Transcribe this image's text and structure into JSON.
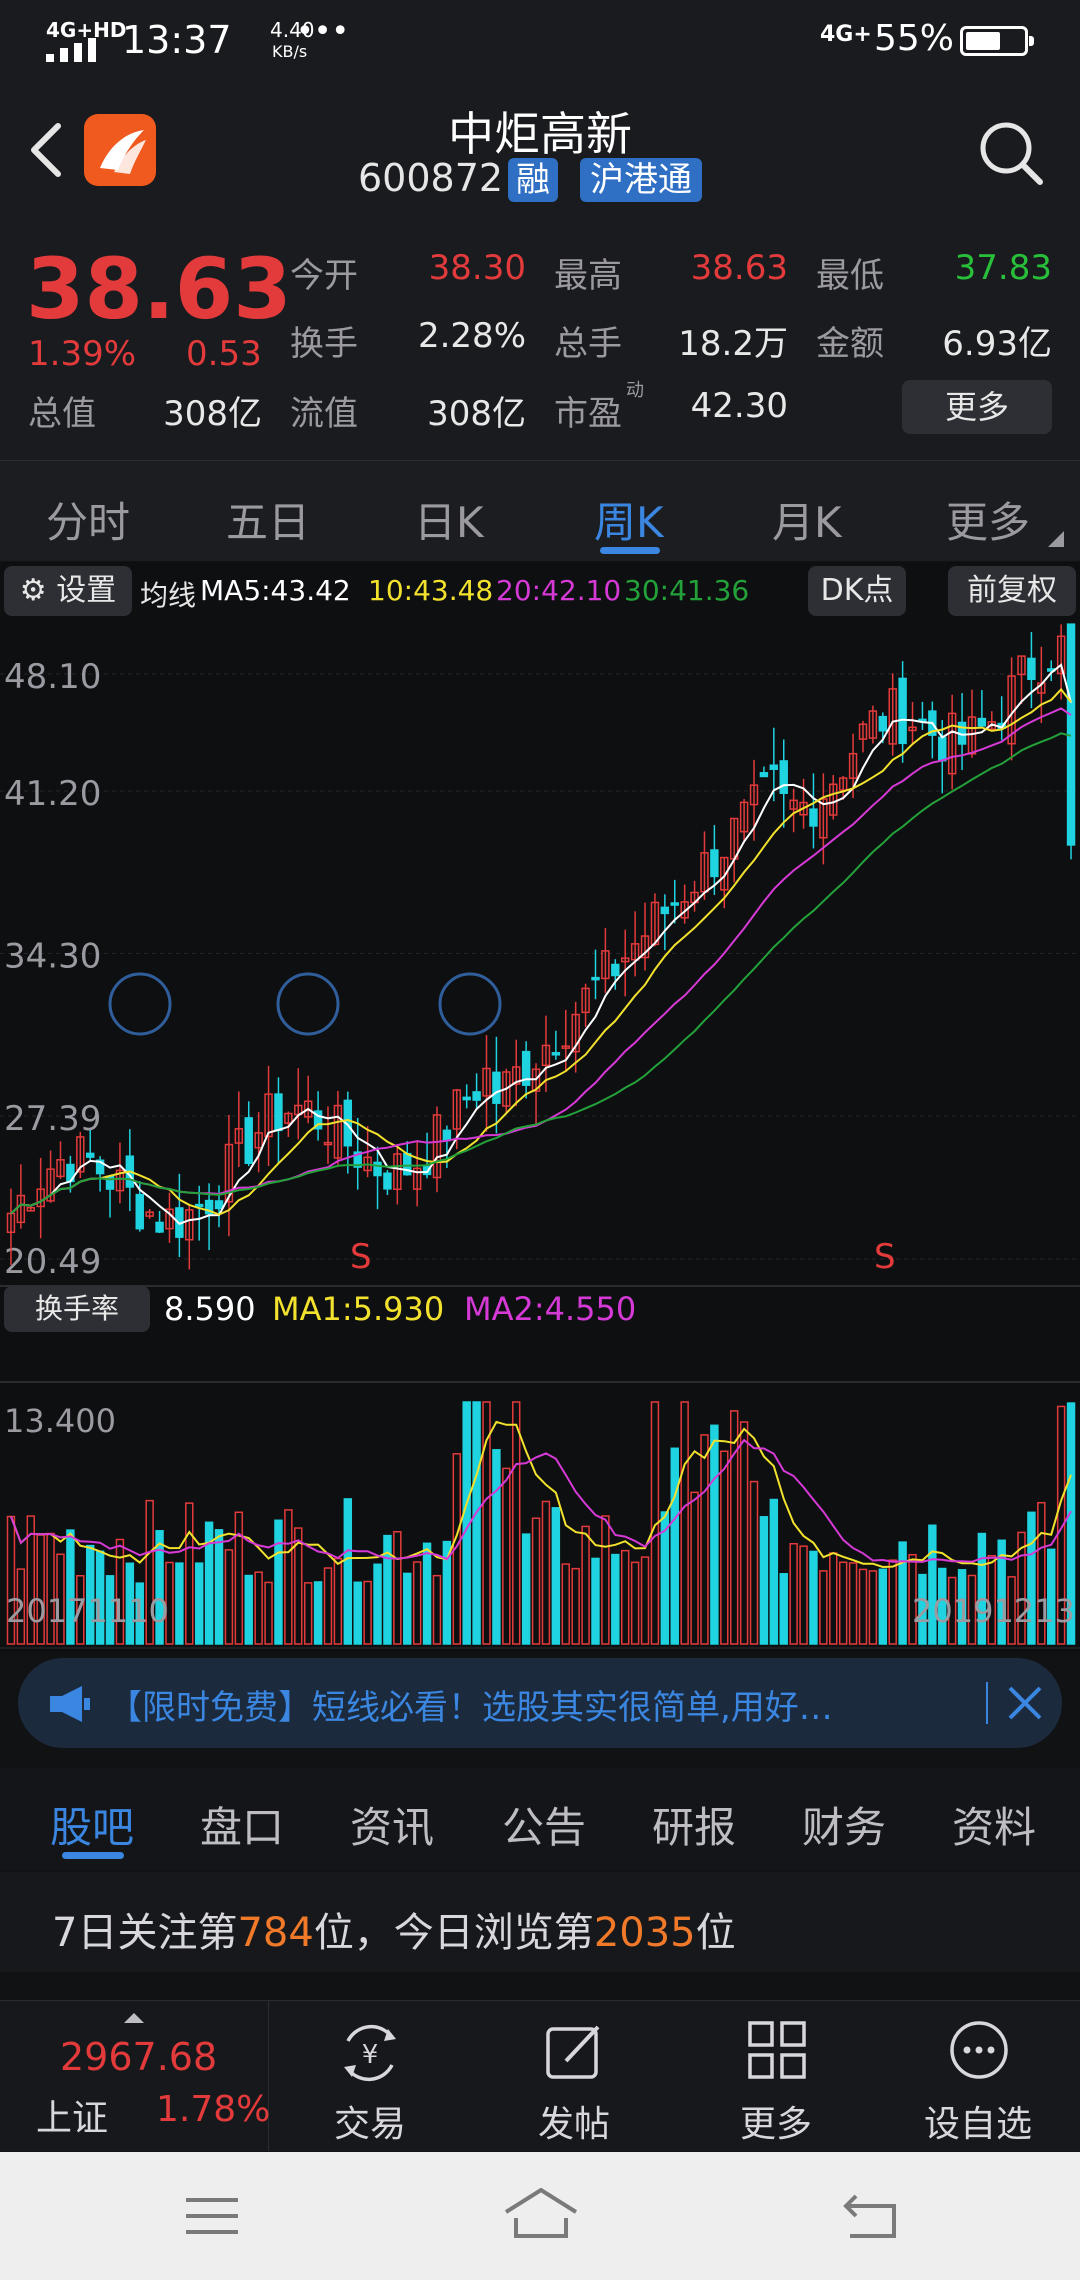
{
  "status": {
    "network": "4G+HD",
    "time": "13:37",
    "speed_value": "4.40",
    "speed_unit": "KB/s",
    "more": "•••",
    "signal2": "4G+",
    "battery": "55%",
    "battery_level": 0.55
  },
  "header": {
    "title": "中炬高新",
    "code": "600872",
    "badge1": "融",
    "badge2": "沪港通"
  },
  "quote": {
    "price": "38.63",
    "change_pct": "1.39%",
    "change_abs": "0.53",
    "open_label": "今开",
    "open": "38.30",
    "high_label": "最高",
    "high": "38.63",
    "low_label": "最低",
    "low": "37.83",
    "turnover_label": "换手",
    "turnover": "2.28%",
    "volume_label": "总手",
    "volume": "18.2万",
    "amount_label": "金额",
    "amount": "6.93亿",
    "mktcap_label": "总值",
    "mktcap": "308亿",
    "float_label": "流值",
    "float": "308亿",
    "pe_label": "市盈",
    "pe_sup": "动",
    "pe": "42.30",
    "more_button": "更多"
  },
  "tabs": [
    "分时",
    "五日",
    "日K",
    "周K",
    "月K",
    "更多"
  ],
  "chart_header": {
    "settings": "设置",
    "ma_label": "均线",
    "ma5": "MA5:43.42",
    "ma10": "10:43.48",
    "ma20": "20:42.10",
    "ma30": "30:41.36",
    "dk": "DK点",
    "adjust": "前复权"
  },
  "chart_data": {
    "type": "candlestick",
    "y_ticks": [
      "48.10",
      "41.20",
      "34.30",
      "27.39",
      "20.49"
    ],
    "ylim": [
      20.49,
      48.1
    ],
    "markers": [
      "S",
      "S"
    ],
    "sub_label": "换手率",
    "sub_value": "8.590",
    "sub_ma1": "MA1:5.930",
    "sub_ma2": "MA2:4.550",
    "sub_ytick": "13.400",
    "x_start": "20171110",
    "x_end": "20191213",
    "colors": {
      "up": "#e33b3b",
      "down": "#1fd3e0",
      "ma5": "#ffffff",
      "ma10": "#f2e22e",
      "ma20": "#d63ad6",
      "ma30": "#24a23a"
    }
  },
  "banner": {
    "text": "【限时免费】短线必看！选股其实很简单,用好…"
  },
  "bottom_tabs": [
    "股吧",
    "盘口",
    "资讯",
    "公告",
    "研报",
    "财务",
    "资料"
  ],
  "info": {
    "p1": "7日关注第",
    "n1": "784",
    "p2": "位，今日浏览第",
    "n2": "2035",
    "p3": "位"
  },
  "toolbar": {
    "index_value": "2967.68",
    "index_name": "上证",
    "index_pct": "1.78%",
    "trade": "交易",
    "post": "发帖",
    "more": "更多",
    "watch": "设自选"
  }
}
